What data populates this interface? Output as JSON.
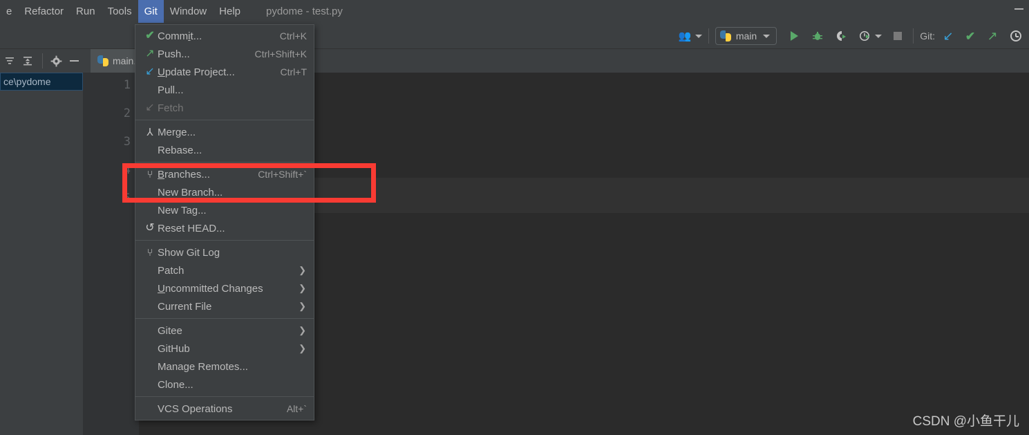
{
  "window": {
    "title": "pydome - test.py",
    "minimize_label": "minimize"
  },
  "menubar": {
    "items": [
      {
        "label": "e",
        "mnemonic": "",
        "active": false
      },
      {
        "label": "Refactor",
        "mnemonic": "R",
        "active": false
      },
      {
        "label": "Run",
        "mnemonic": "u",
        "active": false
      },
      {
        "label": "Tools",
        "mnemonic": "T",
        "active": false
      },
      {
        "label": "Git",
        "mnemonic": "G",
        "active": true
      },
      {
        "label": "Window",
        "mnemonic": "W",
        "active": false
      },
      {
        "label": "Help",
        "mnemonic": "H",
        "active": false
      }
    ]
  },
  "toolbar": {
    "run_config": "main",
    "git_label": "Git:",
    "icons": {
      "people": "people-icon",
      "run": "run-icon",
      "debug": "debug-icon",
      "run_coverage": "run-with-coverage-icon",
      "profile": "profile-icon",
      "stop": "stop-icon",
      "git_update": "git-update-icon",
      "git_commit": "git-commit-icon",
      "git_push": "git-push-icon",
      "git_history": "git-history-icon"
    }
  },
  "project_panel": {
    "toolbar_icons": [
      "collapse-all-icon",
      "expand-all-icon",
      "settings-gear-icon",
      "hide-panel-icon"
    ],
    "selected_item": "ce\\pydome"
  },
  "editor": {
    "tab_label": "main.",
    "line_numbers": [
      "1",
      "2",
      "3",
      "4",
      "5"
    ],
    "code_fragments": [
      {
        "line": 1,
        "text": ")"
      },
      {
        "line": 2,
        "text": "]\")"
      }
    ]
  },
  "git_menu": {
    "items": [
      {
        "label": "Commit...",
        "mnemonic": "i",
        "shortcut": "Ctrl+K",
        "icon": "commit-check-icon",
        "glyph": "✔",
        "glyph_class": "g-check",
        "disabled": false,
        "submenu": false
      },
      {
        "label": "Push...",
        "mnemonic": "",
        "shortcut": "Ctrl+Shift+K",
        "icon": "push-arrow-icon",
        "glyph": "↗",
        "glyph_class": "g-arrow-ne",
        "disabled": false,
        "submenu": false
      },
      {
        "label": "Update Project...",
        "mnemonic": "U",
        "shortcut": "Ctrl+T",
        "icon": "update-arrow-icon",
        "glyph": "↙",
        "glyph_class": "g-arrow-sw",
        "disabled": false,
        "submenu": false
      },
      {
        "label": "Pull...",
        "mnemonic": "",
        "shortcut": "",
        "icon": "",
        "glyph": "",
        "glyph_class": "",
        "disabled": false,
        "submenu": false
      },
      {
        "label": "Fetch",
        "mnemonic": "",
        "shortcut": "",
        "icon": "fetch-arrow-icon",
        "glyph": "↙",
        "glyph_class": "g-arrow-sw dim",
        "disabled": true,
        "submenu": false
      },
      {
        "separator": true
      },
      {
        "label": "Merge...",
        "mnemonic": "",
        "shortcut": "",
        "icon": "merge-icon",
        "glyph": "⅄",
        "glyph_class": "g-merge",
        "disabled": false,
        "submenu": false
      },
      {
        "label": "Rebase...",
        "mnemonic": "",
        "shortcut": "",
        "icon": "",
        "glyph": "",
        "glyph_class": "",
        "disabled": false,
        "submenu": false
      },
      {
        "separator": true
      },
      {
        "label": "Branches...",
        "mnemonic": "B",
        "shortcut": "Ctrl+Shift+`",
        "icon": "branch-icon",
        "glyph": "⑂",
        "glyph_class": "g-branch",
        "disabled": false,
        "submenu": false
      },
      {
        "label": "New Branch...",
        "mnemonic": "",
        "shortcut": "",
        "icon": "",
        "glyph": "",
        "glyph_class": "",
        "disabled": false,
        "submenu": false
      },
      {
        "label": "New Tag...",
        "mnemonic": "",
        "shortcut": "",
        "icon": "",
        "glyph": "",
        "glyph_class": "",
        "disabled": false,
        "submenu": false
      },
      {
        "label": "Reset HEAD...",
        "mnemonic": "",
        "shortcut": "",
        "icon": "reset-icon",
        "glyph": "↺",
        "glyph_class": "g-reset",
        "disabled": false,
        "submenu": false
      },
      {
        "separator": true
      },
      {
        "label": "Show Git Log",
        "mnemonic": "",
        "shortcut": "",
        "icon": "git-log-icon",
        "glyph": "⑂",
        "glyph_class": "g-branch",
        "disabled": false,
        "submenu": false
      },
      {
        "label": "Patch",
        "mnemonic": "",
        "shortcut": "",
        "icon": "",
        "glyph": "",
        "glyph_class": "",
        "disabled": false,
        "submenu": true
      },
      {
        "label": "Uncommitted Changes",
        "mnemonic": "U",
        "shortcut": "",
        "icon": "",
        "glyph": "",
        "glyph_class": "",
        "disabled": false,
        "submenu": true
      },
      {
        "label": "Current File",
        "mnemonic": "",
        "shortcut": "",
        "icon": "",
        "glyph": "",
        "glyph_class": "",
        "disabled": false,
        "submenu": true
      },
      {
        "separator": true
      },
      {
        "label": "Gitee",
        "mnemonic": "",
        "shortcut": "",
        "icon": "",
        "glyph": "",
        "glyph_class": "",
        "disabled": false,
        "submenu": true
      },
      {
        "label": "GitHub",
        "mnemonic": "",
        "shortcut": "",
        "icon": "",
        "glyph": "",
        "glyph_class": "",
        "disabled": false,
        "submenu": true
      },
      {
        "label": "Manage Remotes...",
        "mnemonic": "",
        "shortcut": "",
        "icon": "",
        "glyph": "",
        "glyph_class": "",
        "disabled": false,
        "submenu": false
      },
      {
        "label": "Clone...",
        "mnemonic": "",
        "shortcut": "",
        "icon": "",
        "glyph": "",
        "glyph_class": "",
        "disabled": false,
        "submenu": false
      },
      {
        "separator": true
      },
      {
        "label": "VCS Operations",
        "mnemonic": "",
        "shortcut": "Alt+`",
        "icon": "",
        "glyph": "",
        "glyph_class": "",
        "disabled": false,
        "submenu": false
      }
    ]
  },
  "annotation": {
    "redbox_color": "#f93b33",
    "highlights": [
      "Branches...",
      "New Branch...",
      "New Tag..."
    ]
  },
  "watermark": {
    "text": "CSDN @小鱼干儿"
  },
  "colors": {
    "menu_bg": "#3c3f41",
    "editor_bg": "#2b2b2b",
    "gutter_bg": "#313335",
    "accent_blue": "#4b6eaf",
    "accent_green": "#59a869",
    "annotation_red": "#f93b33"
  }
}
